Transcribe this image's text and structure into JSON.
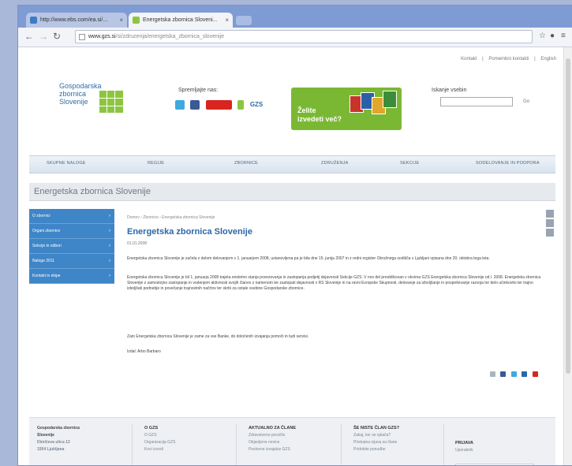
{
  "browser": {
    "tabs": [
      {
        "label": "http://www.ebs.com/ea.si/..."
      },
      {
        "label": "Energetska zbornica Sloveni..."
      }
    ],
    "url": {
      "host": "www.gzs.si",
      "path": "/si/zdruzenja/energetska_zbornica_slovenije"
    }
  },
  "header": {
    "toplinks": [
      "Kontakt",
      "|",
      "Pomembni kontakti",
      "|",
      "English"
    ],
    "logo": [
      "Gospodarska",
      "zbornica",
      "Slovenije"
    ],
    "follow_label": "Spremljajte nas:",
    "gzs_small": "GZS",
    "banner": [
      "Želite",
      "izvedeti več?"
    ],
    "search_label": "Iskanje vsebin",
    "search_go": "Go"
  },
  "nav": [
    "SKUPNE NALOGE",
    "REGIJE",
    "ZBORNICE",
    "ZDRUŽENJA",
    "SEKCIJE",
    "SODELOVANJE IN PODPORA"
  ],
  "page_header": "Energetska zbornica Slovenije",
  "sidebar": [
    "O zbornici",
    "Organi zbornice",
    "Sekcije in odbori",
    "Naloge 2011",
    "Kontakt in ekipe"
  ],
  "content": {
    "breadcrumb": "Domov › Zbornice › Energetska zbornica Slovenije",
    "title": "Energetska zbornica Slovenije",
    "date": "01.01.2008",
    "paragraphs": [
      "Energetska zbornica Slovenije je začela z delom delovanjem v 1. januarjem 2008, ustanovljena pa je bila dne 15. junija 2007 in z redni register Okrožnega sodišča v Ljubljani vpisana dne 20. oktobra tega leta.",
      "Energetska zbornica Slovenije je bil 1. januarja 2008 trajeta enoletno stanja povezovanja in zastopanja podjetij dejavnosti Sekcije GZS. V nov del preoblikovan v okvirna GZS Energetska zbornica Slovenije od l. 2008. Energetska zbornica Slovenije z samostojno zastopanje in vodenjem aktivnosti svojih članov z namenom ter zastopati dejavnosti v RS Slovenije in na ravni Evropske Skupnosti, delovanje za izboljšanje in pospeševanje razvoja ter delo učinkovito ter trajno izboljšati podnebje in povečanje trajnostnih načrtov ter skrbi za ostale vsebine Gospodarske zbornice.",
      "Zato Energetska zbornica Slovenije je zame za vse Banke, do določenih izvajanja pomoči in tudi servisi.",
      "Izdal: Arbo Barbaro"
    ]
  },
  "footer": {
    "address": [
      "Gospodarska zbornica",
      "Slovenije",
      "Dimičeva ulica 13",
      "1504 Ljubljana"
    ],
    "columns": [
      {
        "head": "O GZS",
        "links": [
          "O GZS",
          "Organizacija GZS",
          "Kovi izvodi"
        ]
      },
      {
        "head": "AKTUALNO ZA ČLANE",
        "links": [
          "Zdravstveno poročilo",
          "Objavljene novice",
          "Poslovne izvajalce GZS"
        ]
      },
      {
        "head": "ŠE NISTE ČLAN GZS?",
        "links": [
          "Zakaj, ker se splača?",
          "Pristopna izjava za člane",
          "Pridobite ponudbe"
        ]
      }
    ],
    "login_head": "PRIJAVA",
    "login_label": "Uporabnik"
  },
  "colors": {
    "accent": "#2b67a8",
    "sidebar": "#3f86c8",
    "banner": "#7ab833",
    "logo_green": "#8cc63f"
  }
}
